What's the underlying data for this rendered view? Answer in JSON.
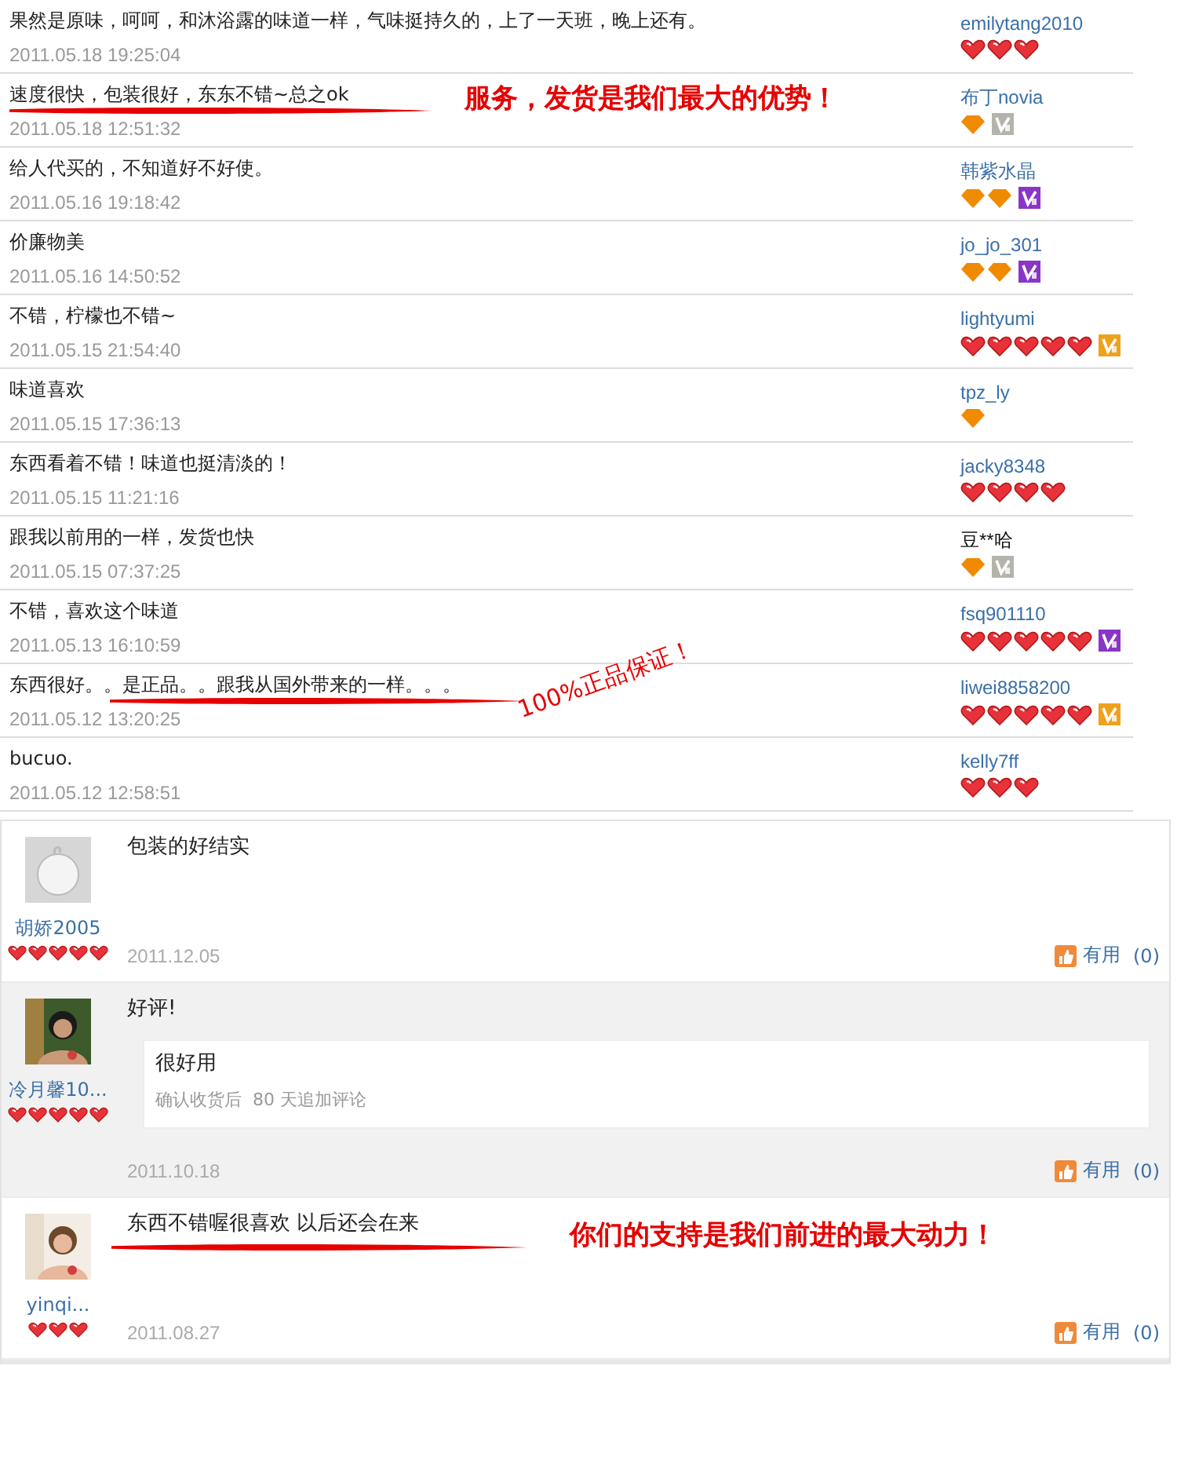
{
  "comments": [
    {
      "text": "果然是原味，呵呵，和沐浴露的味道一样，气味挺持久的，上了一天班，晚上还有。",
      "time": "2011.05.18 19:25:04",
      "user": "emilytang2010",
      "linked": true,
      "rank": [
        {
          "kind": "heart"
        },
        {
          "kind": "heart"
        },
        {
          "kind": "heart"
        }
      ]
    },
    {
      "text": "速度很快，包装很好，东东不错~总之ok",
      "time": "2011.05.18 12:51:32",
      "user": "布丁novia",
      "linked": true,
      "rank": [
        {
          "kind": "diamond"
        }
      ],
      "vip": {
        "color": "#b4b4ac"
      },
      "annotation": {
        "kind": "inline",
        "text": "服务，发货是我们最大的优势！"
      }
    },
    {
      "text": "给人代买的，不知道好不好使。",
      "time": "2011.05.16 19:18:42",
      "user": "韩紫水晶",
      "linked": true,
      "rank": [
        {
          "kind": "diamond"
        },
        {
          "kind": "diamond"
        }
      ],
      "vip": {
        "color": "#8a35c8"
      }
    },
    {
      "text": "价廉物美",
      "time": "2011.05.16 14:50:52",
      "user": "jo_jo_301",
      "linked": true,
      "rank": [
        {
          "kind": "diamond"
        },
        {
          "kind": "diamond"
        }
      ],
      "vip": {
        "color": "#8a35c8"
      }
    },
    {
      "text": "不错，柠檬也不错~",
      "time": "2011.05.15 21:54:40",
      "user": "lightyumi",
      "linked": true,
      "rank": [
        {
          "kind": "heart"
        },
        {
          "kind": "heart"
        },
        {
          "kind": "heart"
        },
        {
          "kind": "heart"
        },
        {
          "kind": "heart"
        }
      ],
      "vip": {
        "color": "#eea21c"
      }
    },
    {
      "text": "味道喜欢",
      "time": "2011.05.15 17:36:13",
      "user": "tpz_ly",
      "linked": true,
      "rank": [
        {
          "kind": "diamond"
        }
      ]
    },
    {
      "text": "东西看着不错！味道也挺清淡的！",
      "time": "2011.05.15 11:21:16",
      "user": "jacky8348",
      "linked": true,
      "rank": [
        {
          "kind": "heart"
        },
        {
          "kind": "heart"
        },
        {
          "kind": "heart"
        },
        {
          "kind": "heart"
        }
      ]
    },
    {
      "text": "跟我以前用的一样，发货也快",
      "time": "2011.05.15 07:37:25",
      "user": "豆**哈",
      "linked": false,
      "rank": [
        {
          "kind": "diamond"
        }
      ],
      "vip": {
        "color": "#b4b4ac"
      }
    },
    {
      "text": "不错，喜欢这个味道",
      "time": "2011.05.13 16:10:59",
      "user": "fsq901110",
      "linked": true,
      "rank": [
        {
          "kind": "heart"
        },
        {
          "kind": "heart"
        },
        {
          "kind": "heart"
        },
        {
          "kind": "heart"
        },
        {
          "kind": "heart"
        }
      ],
      "vip": {
        "color": "#8a35c8"
      }
    },
    {
      "text": "东西很好。。是正品。。跟我从国外带来的一样。。。",
      "time": "2011.05.12 13:20:25",
      "user": "liwei8858200",
      "linked": true,
      "rank": [
        {
          "kind": "heart"
        },
        {
          "kind": "heart"
        },
        {
          "kind": "heart"
        },
        {
          "kind": "heart"
        },
        {
          "kind": "heart"
        }
      ],
      "vip": {
        "color": "#eea21c"
      },
      "annotation": {
        "kind": "tilted",
        "text": "100%正品保证！"
      }
    },
    {
      "text": "bucuo.",
      "time": "2011.05.12 12:58:51",
      "user": "kelly7ff",
      "linked": true,
      "rank": [
        {
          "kind": "heart"
        },
        {
          "kind": "heart"
        },
        {
          "kind": "heart"
        }
      ]
    }
  ],
  "reviews": [
    {
      "kind": "default",
      "user": "胡娇2005",
      "stars": 5,
      "text": "包装的好结实",
      "date": "2011.12.05",
      "useful": "有用",
      "useful_count": "(0)",
      "shaded": false
    },
    {
      "kind": "picture",
      "user": "冷月馨10...",
      "stars": 5,
      "text": "好评!",
      "append": {
        "text": "很好用",
        "note": "确认收货后  80 天追加评论"
      },
      "date": "2011.10.18",
      "useful": "有用",
      "useful_count": "(0)",
      "shaded": true
    },
    {
      "kind": "picture",
      "user": "yinqi...",
      "stars": 3,
      "text": "东西不错喔很喜欢 以后还会在来",
      "annotation": {
        "kind": "inline",
        "text": "你们的支持是我们前进的最大动力！"
      },
      "date": "2011.08.27",
      "useful": "有用",
      "useful_count": "(0)",
      "shaded": false
    }
  ]
}
